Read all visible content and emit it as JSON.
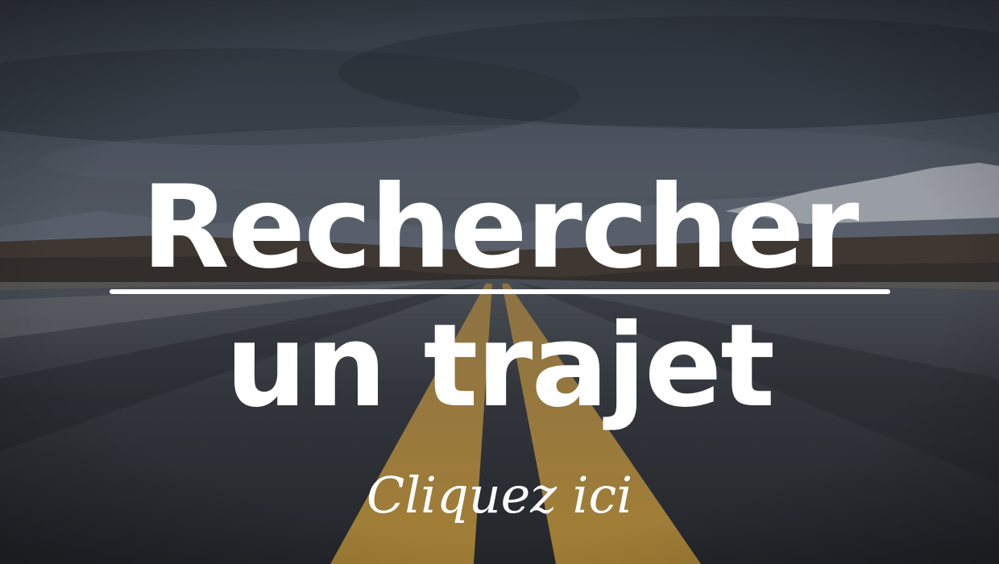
{
  "banner": {
    "title_line1": "Rechercher",
    "title_line2": "un trajet",
    "cta_label": "Cliquez ici"
  },
  "colors": {
    "text": "#ffffff",
    "sky": "#4a5260",
    "road": "#2e3138",
    "center_line": "#d6a43a"
  },
  "background": {
    "icon": "road-landscape-photo"
  }
}
